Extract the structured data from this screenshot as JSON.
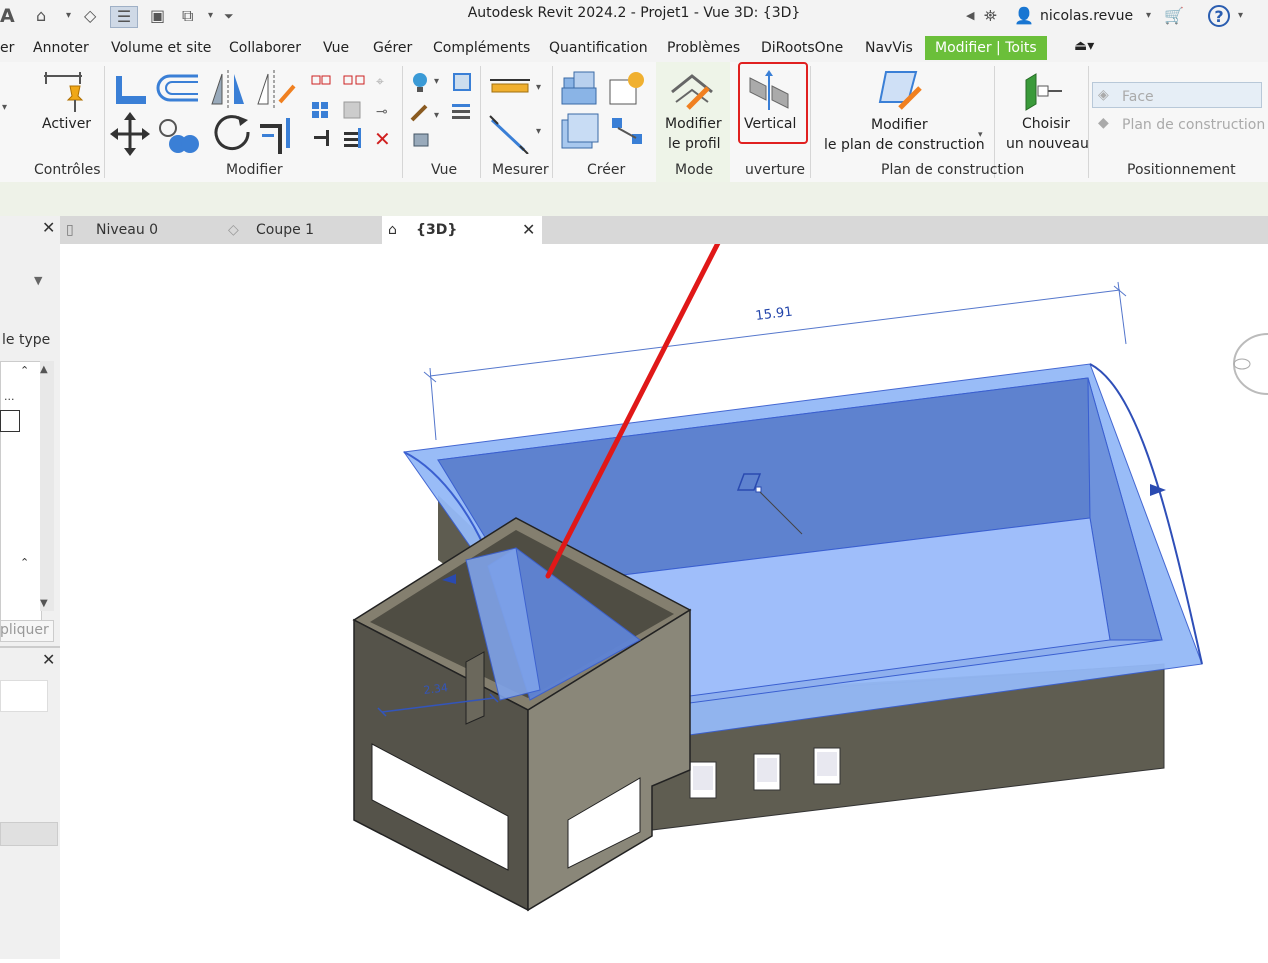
{
  "window": {
    "title": "Autodesk Revit 2024.2 - Projet1 - Vue 3D: {3D}",
    "app_letter": "A",
    "user": "nicolas.revue"
  },
  "ribbon_tabs": {
    "partial_first": "er",
    "annoter": "Annoter",
    "volume": "Volume et site",
    "collaborer": "Collaborer",
    "vue": "Vue",
    "gerer": "Gérer",
    "complements": "Compléments",
    "quantification": "Quantification",
    "problemes": "Problèmes",
    "diroots": "DiRootsOne",
    "navvis": "NavVis",
    "modifier_toits": "Modifier | Toits"
  },
  "ribbon": {
    "activer": "Activer",
    "modifier_profil_1": "Modifier",
    "modifier_profil_2": "le profil",
    "vertical": "Vertical",
    "modifier_plan_1": "Modifier",
    "modifier_plan_2": "le plan de construction",
    "choisir_1": "Choisir",
    "choisir_2": "un nouveau",
    "face": "Face",
    "plan_construction": "Plan de construction",
    "panels": {
      "controles": "Contrôles",
      "modifier": "Modifier",
      "vue": "Vue",
      "mesurer": "Mesurer",
      "creer": "Créer",
      "mode": "Mode",
      "ouverture": "uverture",
      "plan_construction": "Plan de construction",
      "positionnement": "Positionnement"
    },
    "highlight_color": "#e02020"
  },
  "view_tabs": {
    "niveau0": "Niveau 0",
    "coupe1": "Coupe 1",
    "vue3d": "{3D}"
  },
  "left_panel": {
    "type_label": "le type",
    "dots": "...",
    "apply": "pliquer"
  },
  "viewport": {
    "dimension_main": "15.91",
    "dimension_small": "2.34",
    "roof_color": "#6f9cf0",
    "wall_color": "#8a8779",
    "arrow_color": "#e01818"
  }
}
